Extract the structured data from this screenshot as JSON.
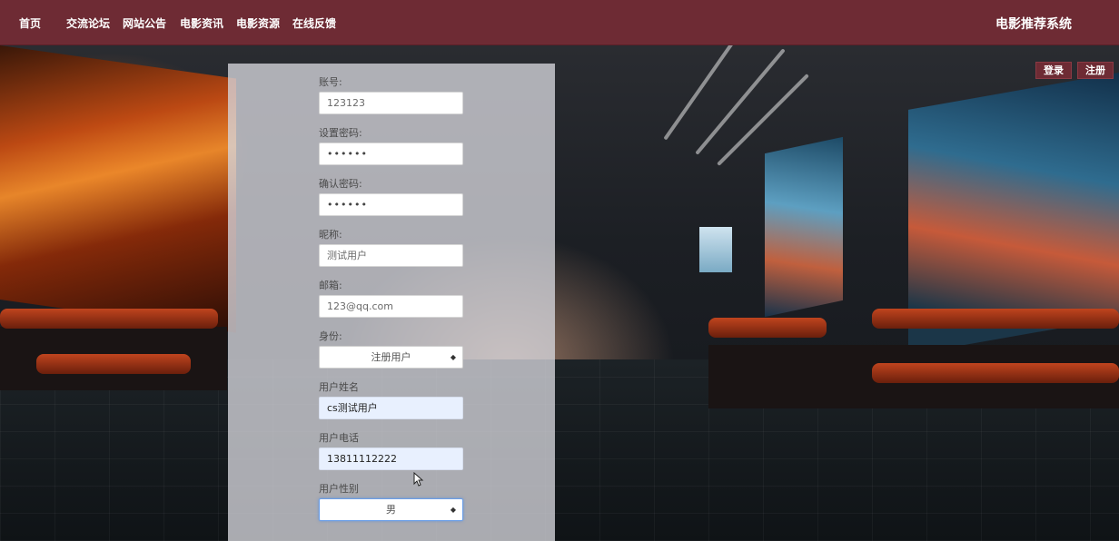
{
  "nav": {
    "items": [
      "首页",
      "交流论坛",
      "网站公告",
      "电影资讯",
      "电影资源",
      "在线反馈"
    ]
  },
  "brand": "电影推荐系统",
  "auth": {
    "login": "登录",
    "register": "注册"
  },
  "form": {
    "account": {
      "label": "账号:",
      "value": "123123"
    },
    "password": {
      "label": "设置密码:",
      "value": "••••••"
    },
    "confirm": {
      "label": "确认密码:",
      "value": "••••••"
    },
    "nickname": {
      "label": "昵称:",
      "value": "测试用户"
    },
    "email": {
      "label": "邮箱:",
      "value": "123@qq.com"
    },
    "role": {
      "label": "身份:",
      "value": "注册用户"
    },
    "realname": {
      "label": "用户姓名",
      "value": "cs测试用户"
    },
    "phone": {
      "label": "用户电话",
      "value": "13811112222"
    },
    "gender": {
      "label": "用户性别",
      "value": "男"
    }
  },
  "colors": {
    "topbar": "#6e2b34",
    "panel": "#d6d6dc",
    "autofill": "#e8f0fe"
  }
}
